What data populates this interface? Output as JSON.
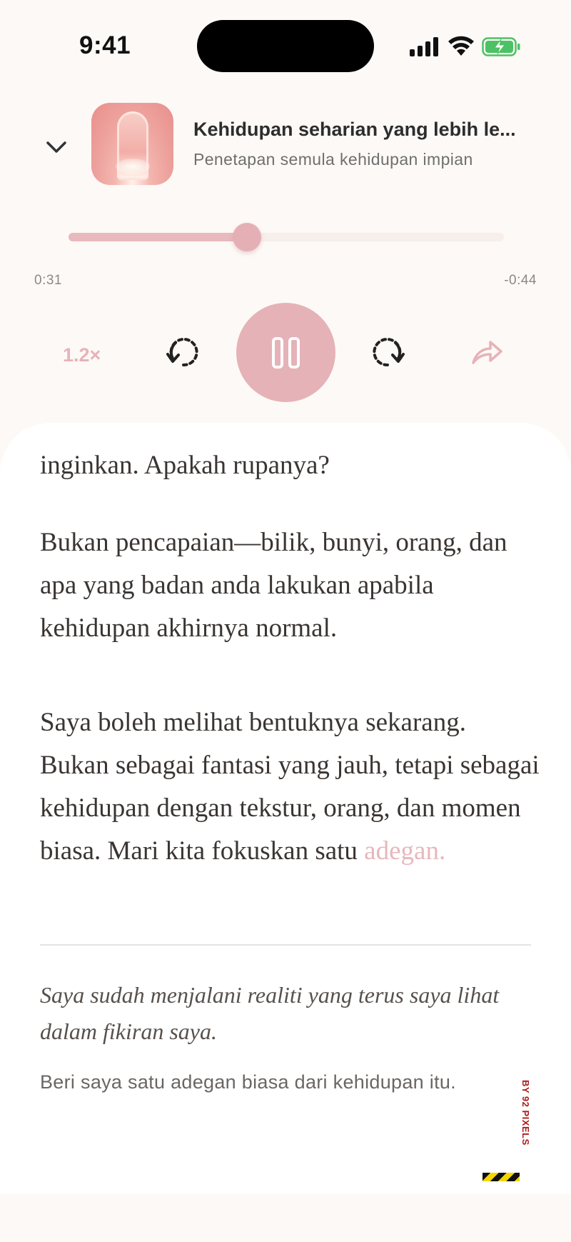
{
  "status": {
    "time": "9:41"
  },
  "now_playing": {
    "title": "Kehidupan seharian yang lebih le...",
    "subtitle": "Penetapan semula kehidupan impian",
    "elapsed": "0:31",
    "remaining": "-0:44",
    "progress_fraction": 0.41,
    "speed": "1.2×"
  },
  "icons": {
    "collapse": "chevron-down-icon",
    "rewind": "rewind-icon",
    "pause": "pause-icon",
    "forward": "forward-icon",
    "share": "share-icon"
  },
  "reader": {
    "p1": "inginkan. Apakah rupanya?",
    "p2": "Bukan pencapaian—bilik, bunyi, orang, dan apa yang badan anda lakukan apabila kehidupan akhirnya normal.",
    "p3_main": "Saya boleh melihat bentuknya sekarang. Bukan sebagai fantasi yang jauh, tetapi sebagai kehidupan dengan tekstur, orang, dan momen biasa. Mari kita fokuskan satu",
    "p3_highlight": "adegan.",
    "quote": "Saya sudah menjalani realiti yang terus saya lihat dalam fikiran saya.",
    "prompt": "Beri saya satu adegan biasa dari kehidupan itu."
  },
  "watermark": "BY 92 PIXELS",
  "colors": {
    "accent": "#e5b2b8",
    "background": "#fdf9f6",
    "text": "#3a3532"
  }
}
